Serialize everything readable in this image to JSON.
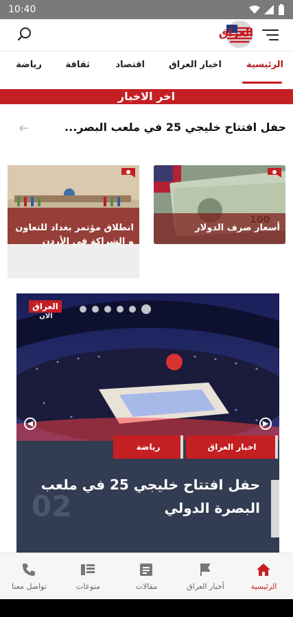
{
  "status_bar": {
    "time": "10:40"
  },
  "header": {
    "logo_text": "العراق"
  },
  "nav": {
    "tabs": [
      "الرئيسية",
      "اخبار العراق",
      "اقتصاد",
      "ثقافة",
      "رياضة"
    ]
  },
  "latest": {
    "banner": "اخر الاخبار",
    "ticker": "حفل افتتاح خليجي 25 في ملعب البصر..."
  },
  "cards": [
    {
      "title": "أسعار صرف الدولار"
    },
    {
      "title": "انطلاق مؤتمر بغداد للتعاون و الشراكة في الأردن"
    }
  ],
  "featured": {
    "watermark": "العراق",
    "watermark_sub": "الان",
    "tags": [
      "اخبار العراق",
      "رياضة"
    ],
    "title": "حفل افتتاح خليجي 25 في ملعب البصرة الدولي",
    "number": "02"
  },
  "bottom_nav": {
    "items": [
      "الرئيسية",
      "أخبار العراق",
      "مقالات",
      "منوعات",
      "تواصل معنا"
    ]
  },
  "colors": {
    "accent": "#c41f23",
    "featured_bg": "#323c52"
  }
}
